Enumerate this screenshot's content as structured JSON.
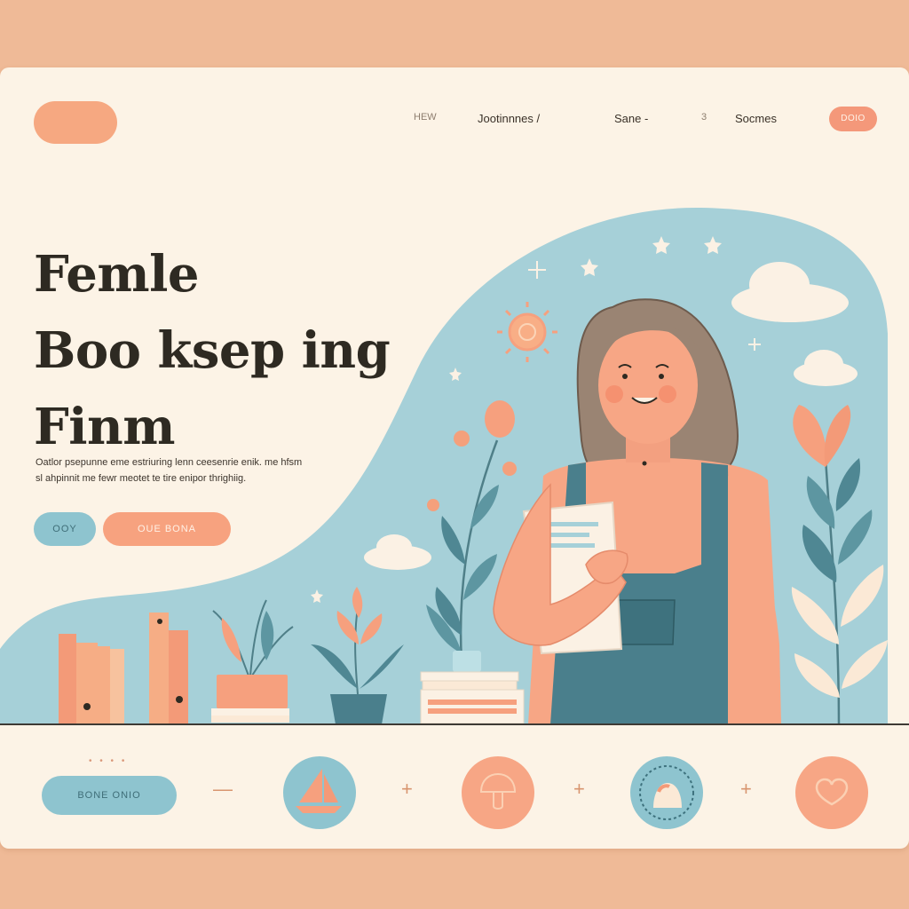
{
  "nav": {
    "items": [
      {
        "label": "HEW"
      },
      {
        "label": "Jootinnnes /"
      },
      {
        "label": "Sane -"
      },
      {
        "label": "3"
      },
      {
        "label": "Socmes"
      }
    ],
    "cta": "DOIO"
  },
  "hero": {
    "title_lines": [
      "Femle",
      "Boo ksep ing",
      "Finm"
    ],
    "description_lines": [
      "Oatlor psepunne eme estriuring lenn ceesenrie enik. me hfsm",
      "sl ahpinnit me fewr meotet te tire enipor thrighiig."
    ],
    "buttons": {
      "primary": "OOY",
      "secondary": "OUE BONA"
    }
  },
  "footer": {
    "dots": "• • • •",
    "button": "BONE ONIO",
    "separators": [
      "—",
      "+",
      "+",
      "+"
    ]
  },
  "colors": {
    "background": "#efba97",
    "card": "#fcf3e6",
    "peach": "#f6a881",
    "blue": "#8ec4cf",
    "text": "#2e2a22"
  },
  "icons": [
    "sailboat-icon",
    "mushroom-icon",
    "rock-icon",
    "heart-icon"
  ]
}
